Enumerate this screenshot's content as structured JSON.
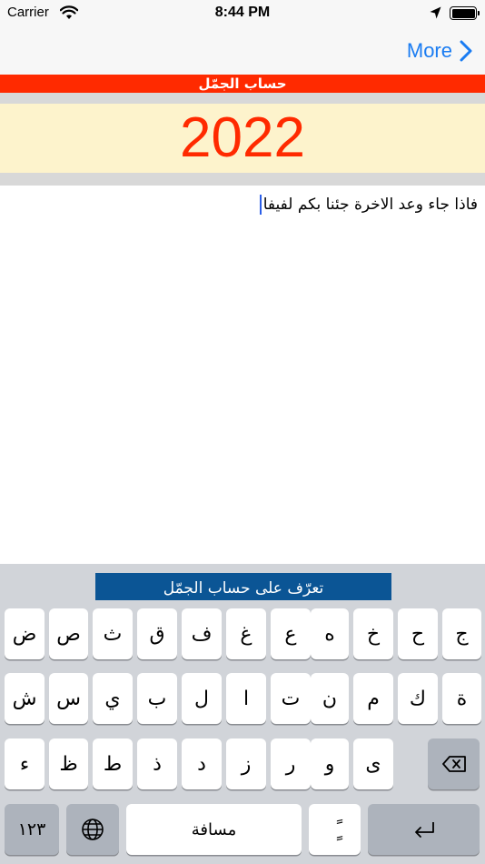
{
  "status_bar": {
    "carrier": "Carrier",
    "time": "8:44 PM"
  },
  "nav": {
    "more_label": "More",
    "accent_color": "#1a7cf2"
  },
  "app": {
    "title": "حساب الجمّل",
    "result": "2022",
    "input_text": "فاذا جاء وعد الاخرة جئنا بكم لفيفا",
    "info_button": "تعرّف على حساب الجمّل",
    "title_color": "#ff2a00",
    "result_bg": "#fdf3cc"
  },
  "keyboard": {
    "row1": [
      "ض",
      "ص",
      "ث",
      "ق",
      "ف",
      "غ",
      "ع",
      "ه",
      "خ",
      "ح",
      "ج"
    ],
    "row2": [
      "ش",
      "س",
      "ي",
      "ب",
      "ل",
      "ا",
      "ت",
      "ن",
      "م",
      "ك",
      "ة"
    ],
    "row3": [
      "ء",
      "ظ",
      "ط",
      "ذ",
      "د",
      "ز",
      "ر",
      "و",
      "ى"
    ],
    "numbers_label": "١٢٣",
    "space_label": "مسافة",
    "diacritic_label": "ًٍ",
    "icons": {
      "globe": "globe-icon",
      "delete": "delete-icon",
      "return": "return-icon"
    }
  }
}
